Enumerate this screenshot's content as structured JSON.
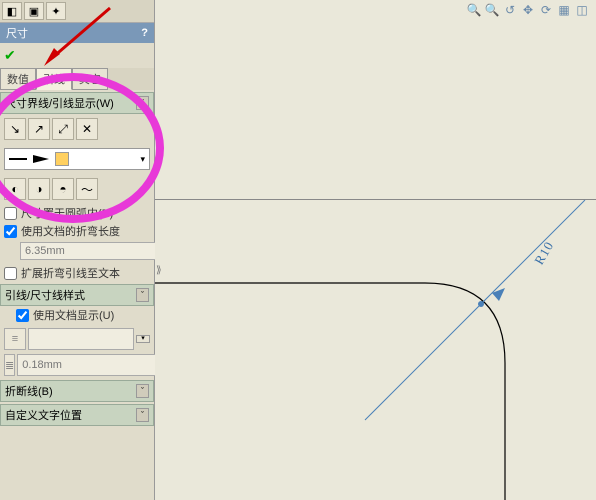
{
  "panel": {
    "title": "尺寸",
    "help": "?"
  },
  "tabs3": {
    "a": "数值",
    "b": "引线",
    "c": "其它"
  },
  "sec1": {
    "title": "尺寸界线/引线显示(W)"
  },
  "chk_arc": "尺寸置于圆弧内(R)",
  "chk_bend": "使用文档的折弯长度",
  "bend_len": "6.35mm",
  "chk_extend": "扩展折弯引线至文本",
  "sec2": {
    "title": "引线/尺寸线样式"
  },
  "chk_docdisp": "使用文档显示(U)",
  "thick": "0.18mm",
  "sec3": {
    "title": "折断线(B)"
  },
  "sec4": {
    "title": "自定义文字位置"
  },
  "dim_value": "R10"
}
